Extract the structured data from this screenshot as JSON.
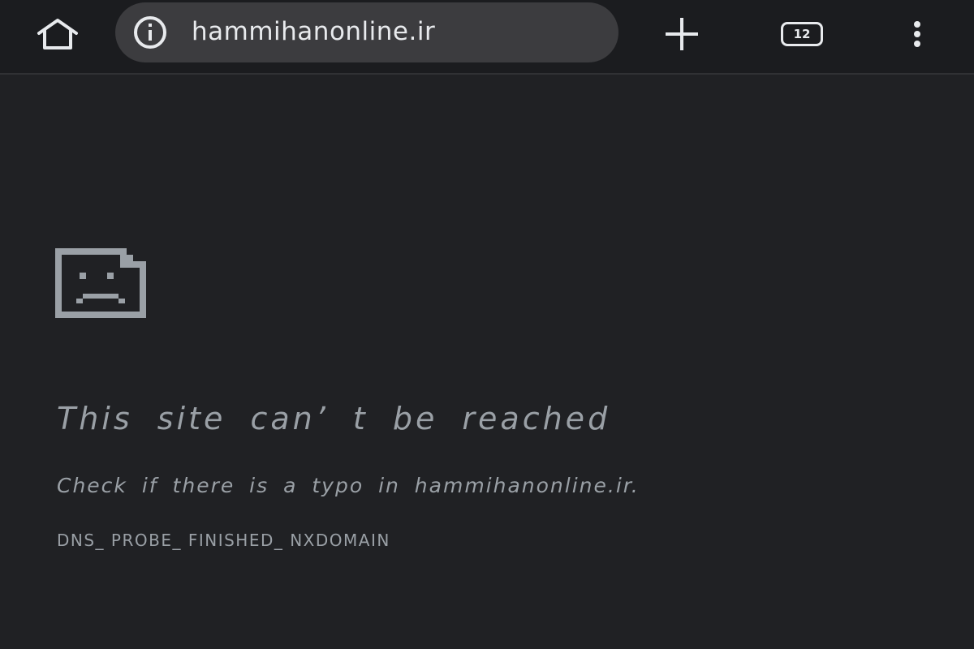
{
  "toolbar": {
    "home_icon": "home-icon",
    "info_icon": "info-icon",
    "url": "hammihanonline.ir",
    "new_tab_icon": "plus-icon",
    "tab_count": "12",
    "menu_icon": "vertical-dots-icon"
  },
  "error_page": {
    "icon": "sad-page-icon",
    "title": "This site can’ t be reached",
    "description": "Check if there is a typo in hammihanonline.ir.",
    "error_code": "DNS_ PROBE_ FINISHED_ NXDOMAIN"
  },
  "colors": {
    "page_background": "#202124",
    "toolbar_background": "#1b1c1f",
    "omnibox_background": "#3c3c3f",
    "toolbar_icon": "#e8eaed",
    "error_text": "#9aa0a6"
  }
}
